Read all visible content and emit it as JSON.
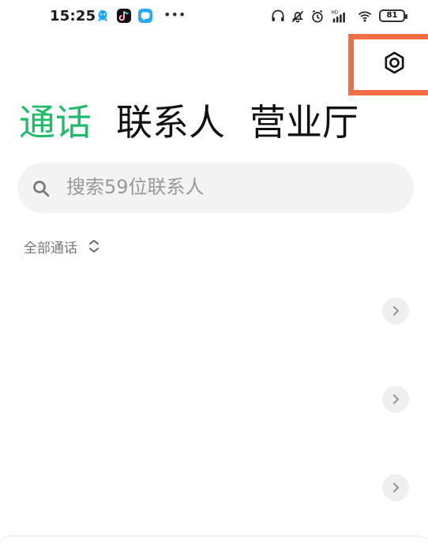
{
  "status_bar": {
    "time": "15:25",
    "battery": "81",
    "icons": [
      "qq-icon",
      "tiktok-icon",
      "bubble-icon",
      "more-icon",
      "headphone-icon",
      "mute-icon",
      "alarm-icon",
      "signal-icon",
      "wifi-icon"
    ]
  },
  "tabs": [
    {
      "label": "通话",
      "active": true
    },
    {
      "label": "联系人",
      "active": false
    },
    {
      "label": "营业厅",
      "active": false
    }
  ],
  "search": {
    "placeholder": "搜索59位联系人"
  },
  "filter": {
    "label": "全部通话"
  },
  "colors": {
    "accent": "#1fbb68",
    "highlight": "#f36d47",
    "text_primary": "#111111",
    "text_secondary": "#999999"
  }
}
